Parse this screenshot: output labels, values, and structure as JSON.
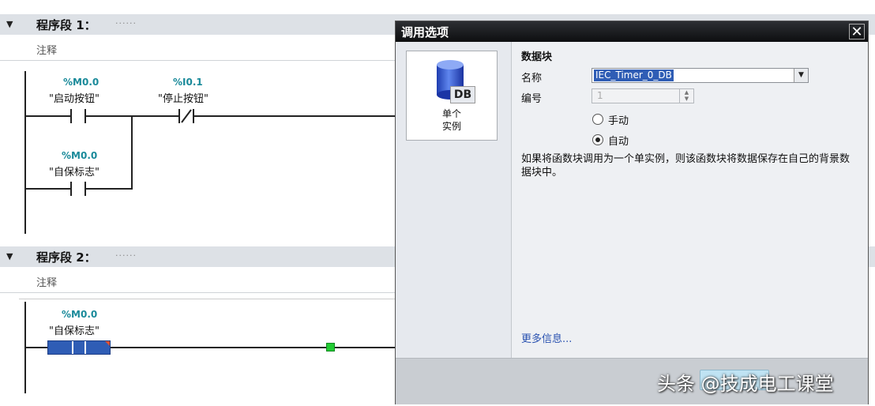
{
  "networks": [
    {
      "title": "程序段 1：",
      "dots": "......",
      "comment": "注释",
      "contacts": [
        {
          "address": "%M0.0",
          "symbol": "\"启动按钮\""
        },
        {
          "address": "%I0.1",
          "symbol": "\"停止按钮\""
        },
        {
          "address": "%M0.0",
          "symbol": "\"自保标志\""
        }
      ]
    },
    {
      "title": "程序段 2：",
      "dots": "......",
      "comment": "注释",
      "contacts": [
        {
          "address": "%M0.0",
          "symbol": "\"自保标志\""
        }
      ]
    }
  ],
  "dialog": {
    "title": "调用选项",
    "close_icon": "close-icon",
    "tile": {
      "icon_text": "DB",
      "label_line1": "单个",
      "label_line2": "实例"
    },
    "section_title": "数据块",
    "name_label": "名称",
    "name_value": "IEC_Timer_0_DB",
    "number_label": "编号",
    "number_value": "1",
    "radio_manual": "手动",
    "radio_auto": "自动",
    "selected_radio": "auto",
    "description": "如果将函数块调用为一个单实例，则该函数块将数据保存在自己的背景数据块中。",
    "more_info": "更多信息..."
  },
  "watermark": "头条 @技成电工课堂",
  "colors": {
    "address": "#1a8a9a",
    "selection": "#2f5db5",
    "coil_green": "#22cc33"
  }
}
